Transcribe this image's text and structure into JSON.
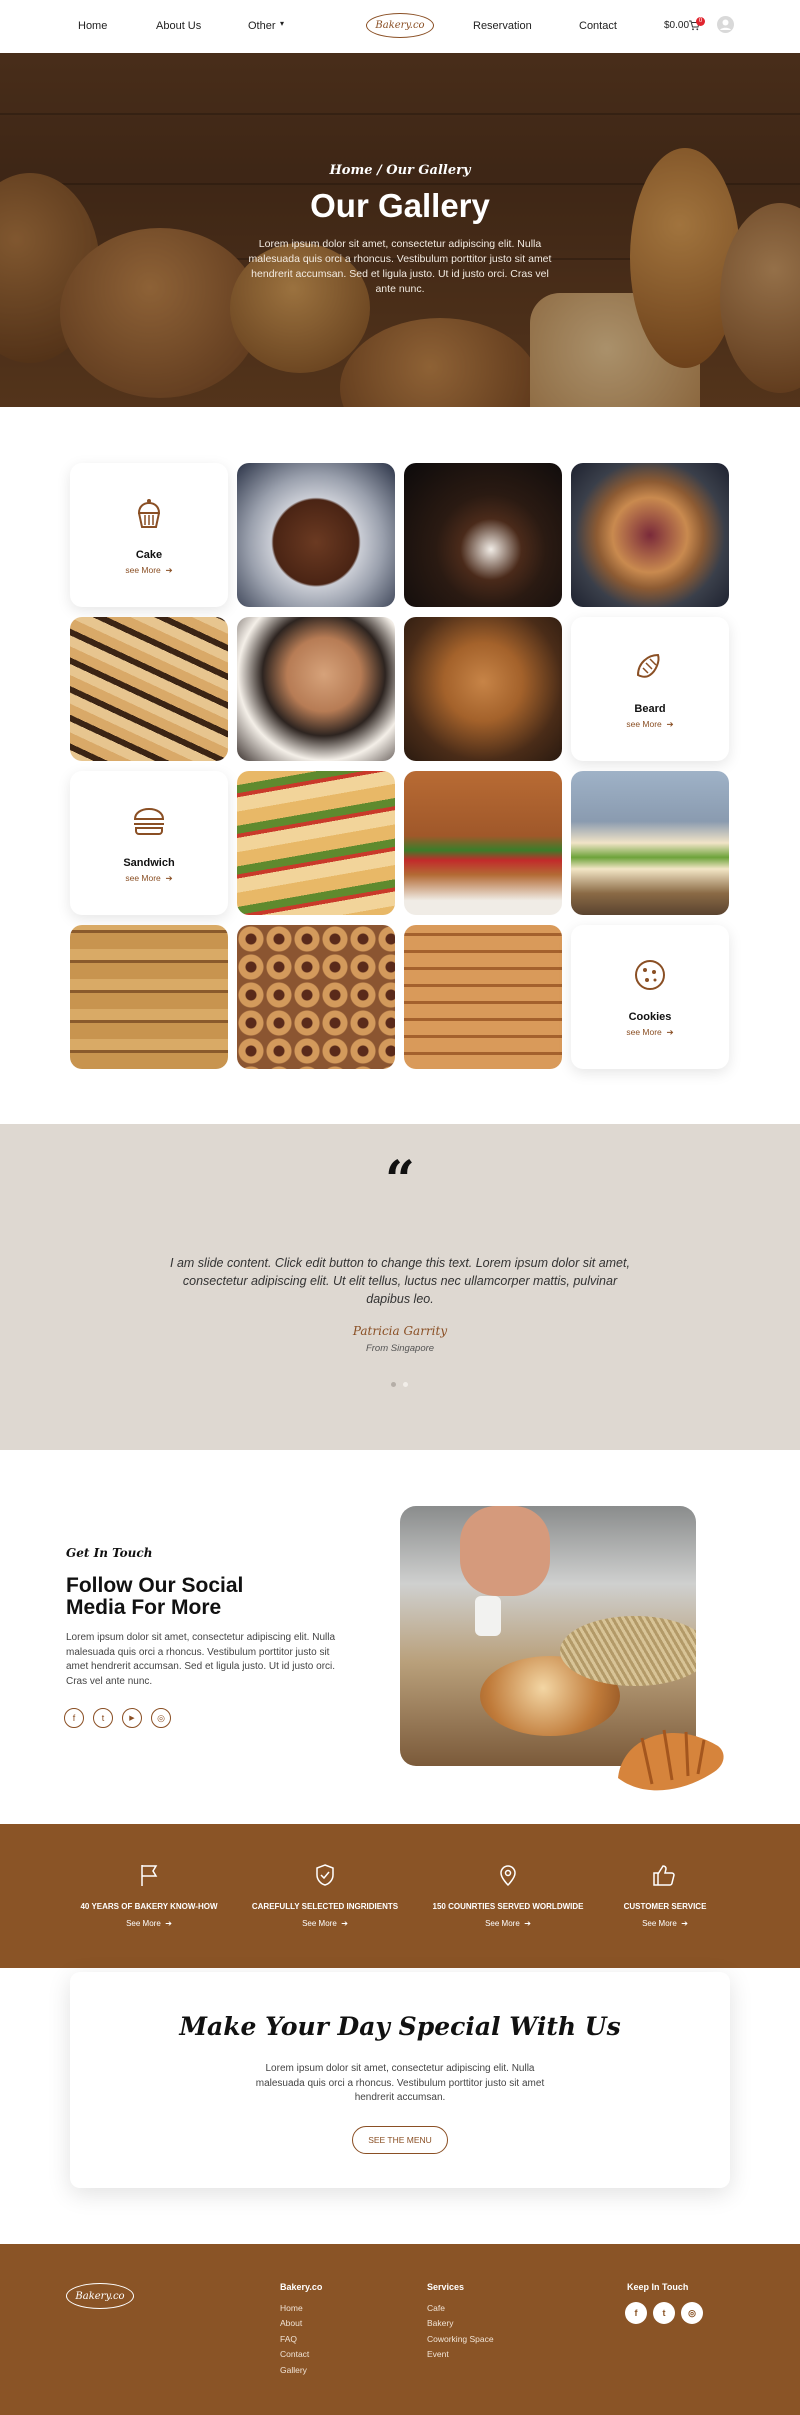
{
  "header": {
    "nav_left": [
      "Home",
      "About Us",
      "Other"
    ],
    "brand": "Bakery.co",
    "nav_right": [
      "Reservation",
      "Contact"
    ],
    "cart_total": "$0.00",
    "cart_count": "0"
  },
  "hero": {
    "breadcrumb": "Home /  Our Gallery",
    "title": "Our Gallery",
    "text": "Lorem ipsum dolor sit amet, consectetur adipiscing elit. Nulla malesuada quis orci a rhoncus. Vestibulum porttitor justo sit amet hendrerit accumsan. Sed et ligula justo. Ut id justo orci. Cras vel ante nunc."
  },
  "gallery": {
    "see_more": "see More",
    "categories": [
      {
        "title": "Cake",
        "icon": "cupcake-icon"
      },
      {
        "title": "Beard",
        "icon": "croissant-icon"
      },
      {
        "title": "Sandwich",
        "icon": "burger-icon"
      },
      {
        "title": "Cookies",
        "icon": "cookie-icon"
      }
    ],
    "photos": [
      "chocolate-cake-photo",
      "bundt-cake-photo",
      "galette-photo",
      "marble-loaf-photo",
      "pizza-dough-photo",
      "croissant-loaf-photo",
      "sub-sandwich-photo",
      "burger-photo",
      "club-sandwich-photo",
      "granola-cookie-stack-photo",
      "thumbprint-cookies-photo",
      "cookie-stack-twine-photo"
    ]
  },
  "testimonial": {
    "quote_mark": "“",
    "text": "I am slide content. Click edit button to change this text. Lorem ipsum dolor sit amet, consectetur adipiscing elit. Ut elit tellus, luctus nec ullamcorper mattis, pulvinar dapibus leo.",
    "author": "Patricia Garrity",
    "origin": "From Singapore",
    "slides": 2,
    "active_slide": 1
  },
  "social": {
    "kicker": "Get In Touch",
    "title_line1": "Follow Our Social",
    "title_line2": "Media For More",
    "text": "Lorem ipsum dolor sit amet, consectetur adipiscing elit. Nulla malesuada quis orci a rhoncus. Vestibulum porttitor justo sit amet hendrerit accumsan. Sed et ligula justo. Ut id justo orci. Cras vel ante nunc.",
    "icons": [
      "f",
      "t",
      "▶",
      "◎"
    ]
  },
  "features": {
    "see_more": "See More",
    "items": [
      {
        "title": "40 YEARS OF BAKERY KNOW-HOW",
        "icon": "flag-icon"
      },
      {
        "title": "CAREFULLY SELECTED INGRIDIENTS",
        "icon": "shield-check-icon"
      },
      {
        "title": "150 COUNRTIES SERVED WORLDWIDE",
        "icon": "map-pin-icon"
      },
      {
        "title": "CUSTOMER SERVICE",
        "icon": "thumbs-up-icon"
      }
    ]
  },
  "cta": {
    "title": "Make Your Day Special With Us",
    "text": "Lorem ipsum dolor sit amet, consectetur adipiscing elit. Nulla malesuada quis orci a rhoncus. Vestibulum porttitor justo sit amet hendrerit accumsan.",
    "button": "SEE THE MENU"
  },
  "footer": {
    "brand": "Bakery.co",
    "col1_title": "Bakery.co",
    "col1": [
      "Home",
      "About",
      "FAQ",
      "Contact",
      "Gallery"
    ],
    "col2_title": "Services",
    "col2": [
      "Cafe",
      "Bakery",
      "Coworking Space",
      "Event"
    ],
    "col3_title": "Keep In Touch",
    "col3_icons": [
      "f",
      "t",
      "◎"
    ]
  },
  "colors": {
    "accent": "#8a5426",
    "testimonial_bg": "#ded8d1",
    "badge": "#e0252f"
  }
}
